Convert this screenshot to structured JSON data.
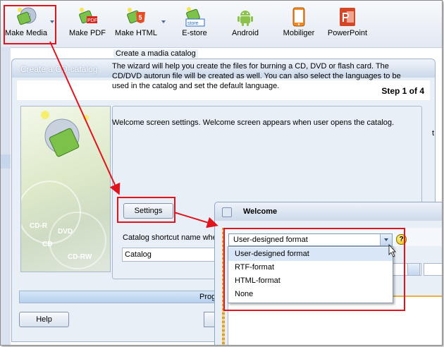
{
  "toolbar": {
    "items": [
      {
        "label": "Make Media",
        "icon": "make-media-icon"
      },
      {
        "label": "Make PDF",
        "icon": "make-pdf-icon"
      },
      {
        "label": "Make HTML",
        "icon": "make-html-icon"
      },
      {
        "label": "E-store",
        "icon": "estore-icon"
      },
      {
        "label": "Android",
        "icon": "android-icon"
      },
      {
        "label": "Mobiliger",
        "icon": "mobile-icon"
      },
      {
        "label": "PowerPoint",
        "icon": "powerpoint-icon"
      }
    ],
    "pdf_badge": "PDF",
    "html_badge": "5",
    "estore_badge": "store"
  },
  "dialog": {
    "title": "Create a CD-catalog",
    "step": "Step 1 of 4",
    "group_title": "Create a madia catalog",
    "description": "The wizard will help you create the files for burning a CD, DVD or flash card. The CD/DVD autorun file will be created as well. You can also select the languages to be used in the catalog and set the default language.",
    "welcome_text": "Welcome screen settings. Welcome screen appears when user opens the catalog.",
    "settings_button": "Settings",
    "shortcut_label": "Catalog shortcut name whe",
    "shortcut_value": "Catalog",
    "progress_text": "Prog",
    "help_button": "Help",
    "right_text": "t",
    "art_labels": {
      "cdr": "CD-R",
      "dvd": "DVD",
      "cd": "CD",
      "cdrw": "CD-RW"
    }
  },
  "welcome_window": {
    "title": "Welcome",
    "combo_value": "User-designed format",
    "help_mark": "?",
    "options": [
      "User-designed format",
      "RTF-format",
      "HTML-format",
      "None"
    ],
    "selected_index": 0
  },
  "colors": {
    "annotation_red": "#e0141c",
    "toolbar_bg": "#e3e9f2",
    "dialog_bg": "#e9eff7",
    "selection_bg": "#d9e6f7"
  }
}
